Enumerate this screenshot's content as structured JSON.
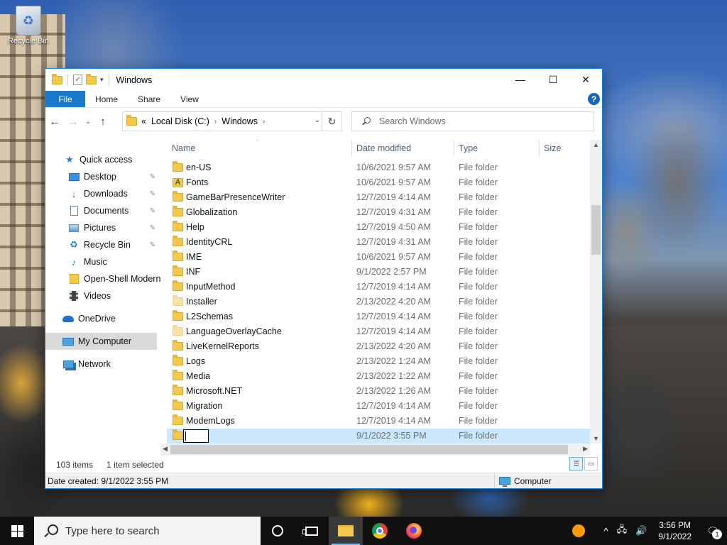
{
  "desktop": {
    "recycle_bin_label": "Recycle Bin"
  },
  "window": {
    "title": "Windows",
    "minimize_glyph": "—",
    "maximize_glyph": "☐",
    "close_glyph": "✕"
  },
  "ribbon": {
    "tabs": [
      {
        "label": "File",
        "active": true
      },
      {
        "label": "Home"
      },
      {
        "label": "Share"
      },
      {
        "label": "View"
      }
    ],
    "help_glyph": "?"
  },
  "navigation": {
    "back_glyph": "←",
    "forward_glyph": "→",
    "recent_glyph": "⌄",
    "up_glyph": "↑",
    "address": {
      "overflow": "«",
      "crumbs": [
        "Local Disk (C:)",
        "Windows"
      ],
      "separator": "›"
    },
    "refresh_glyph": "↻",
    "search_placeholder": "Search Windows"
  },
  "nav_pane": {
    "items": [
      {
        "label": "Quick access",
        "icon": "star-icon",
        "pinned": false
      },
      {
        "label": "Desktop",
        "icon": "desktop-icon",
        "pinned": true
      },
      {
        "label": "Downloads",
        "icon": "downloads-icon",
        "pinned": true
      },
      {
        "label": "Documents",
        "icon": "documents-icon",
        "pinned": true
      },
      {
        "label": "Pictures",
        "icon": "pictures-icon",
        "pinned": true
      },
      {
        "label": "Recycle Bin",
        "icon": "recycle-bin-icon",
        "pinned": true
      },
      {
        "label": "Music",
        "icon": "music-icon",
        "pinned": false
      },
      {
        "label": "Open-Shell Modern",
        "icon": "folder-icon",
        "pinned": false
      },
      {
        "label": "Videos",
        "icon": "videos-icon",
        "pinned": false
      },
      {
        "label": "OneDrive",
        "icon": "onedrive-icon",
        "pinned": false
      },
      {
        "label": "My Computer",
        "icon": "computer-icon",
        "pinned": false,
        "selected": true
      },
      {
        "label": "Network",
        "icon": "network-icon",
        "pinned": false
      }
    ],
    "pin_glyph": "📌"
  },
  "file_list": {
    "columns": {
      "name": "Name",
      "date": "Date modified",
      "type": "Type",
      "size": "Size"
    },
    "sort_glyph": "^",
    "rows": [
      {
        "name": "en-US",
        "date": "10/6/2021 9:57 AM",
        "type": "File folder"
      },
      {
        "name": "Fonts",
        "date": "10/6/2021 9:57 AM",
        "type": "File folder",
        "icon": "fonts-folder-icon"
      },
      {
        "name": "GameBarPresenceWriter",
        "date": "12/7/2019 4:14 AM",
        "type": "File folder"
      },
      {
        "name": "Globalization",
        "date": "12/7/2019 4:31 AM",
        "type": "File folder"
      },
      {
        "name": "Help",
        "date": "12/7/2019 4:50 AM",
        "type": "File folder"
      },
      {
        "name": "IdentityCRL",
        "date": "12/7/2019 4:31 AM",
        "type": "File folder"
      },
      {
        "name": "IME",
        "date": "10/6/2021 9:57 AM",
        "type": "File folder"
      },
      {
        "name": "INF",
        "date": "9/1/2022 2:57 PM",
        "type": "File folder"
      },
      {
        "name": "InputMethod",
        "date": "12/7/2019 4:14 AM",
        "type": "File folder"
      },
      {
        "name": "Installer",
        "date": "2/13/2022 4:20 AM",
        "type": "File folder",
        "faded": true
      },
      {
        "name": "L2Schemas",
        "date": "12/7/2019 4:14 AM",
        "type": "File folder"
      },
      {
        "name": "LanguageOverlayCache",
        "date": "12/7/2019 4:14 AM",
        "type": "File folder",
        "faded": true
      },
      {
        "name": "LiveKernelReports",
        "date": "2/13/2022 4:20 AM",
        "type": "File folder"
      },
      {
        "name": "Logs",
        "date": "2/13/2022 1:24 AM",
        "type": "File folder"
      },
      {
        "name": "Media",
        "date": "2/13/2022 1:22 AM",
        "type": "File folder"
      },
      {
        "name": "Microsoft.NET",
        "date": "2/13/2022 1:26 AM",
        "type": "File folder"
      },
      {
        "name": "Migration",
        "date": "12/7/2019 4:14 AM",
        "type": "File folder"
      },
      {
        "name": "ModemLogs",
        "date": "12/7/2019 4:14 AM",
        "type": "File folder"
      },
      {
        "name": "",
        "date": "9/1/2022 3:55 PM",
        "type": "File folder",
        "selected": true,
        "renaming": true
      }
    ]
  },
  "status": {
    "item_count": "103 items",
    "selection": "1 item selected"
  },
  "details_bar": {
    "created": "Date created: 9/1/2022 3:55 PM",
    "location": "Computer"
  },
  "taskbar": {
    "search_placeholder": "Type here to search",
    "tray_chevron": "^",
    "time": "3:56 PM",
    "date": "9/1/2022",
    "notification_count": "1"
  },
  "colors": {
    "accent": "#1979ca",
    "selection": "#cce8ff",
    "folder": "#f5c94b"
  }
}
